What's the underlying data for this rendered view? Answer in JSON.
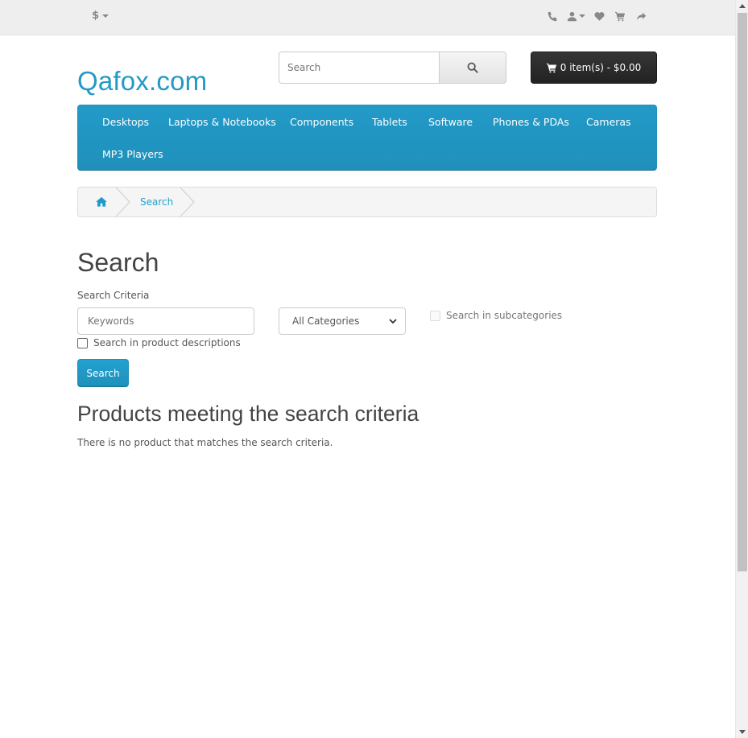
{
  "topbar": {
    "currency": "$",
    "icons": [
      "phone-icon",
      "user-icon",
      "heart-icon",
      "cart-icon",
      "share-icon"
    ]
  },
  "header": {
    "logo": "Qafox.com",
    "search_placeholder": "Search",
    "cart_label": "0 item(s) - $0.00"
  },
  "nav": {
    "items": [
      "Desktops",
      "Laptops & Notebooks",
      "Components",
      "Tablets",
      "Software",
      "Phones & PDAs",
      "Cameras",
      "MP3 Players"
    ]
  },
  "breadcrumb": {
    "items": [
      "Search"
    ]
  },
  "main": {
    "title": "Search",
    "criteria_label": "Search Criteria",
    "keywords_placeholder": "Keywords",
    "category_selected": "All Categories",
    "subcategories_label": "Search in subcategories",
    "descriptions_label": "Search in product descriptions",
    "search_button": "Search",
    "results_title": "Products meeting the search criteria",
    "empty_message": "There is no product that matches the search criteria."
  },
  "colors": {
    "brand_blue": "#229ac8",
    "cart_dark": "#222222"
  }
}
